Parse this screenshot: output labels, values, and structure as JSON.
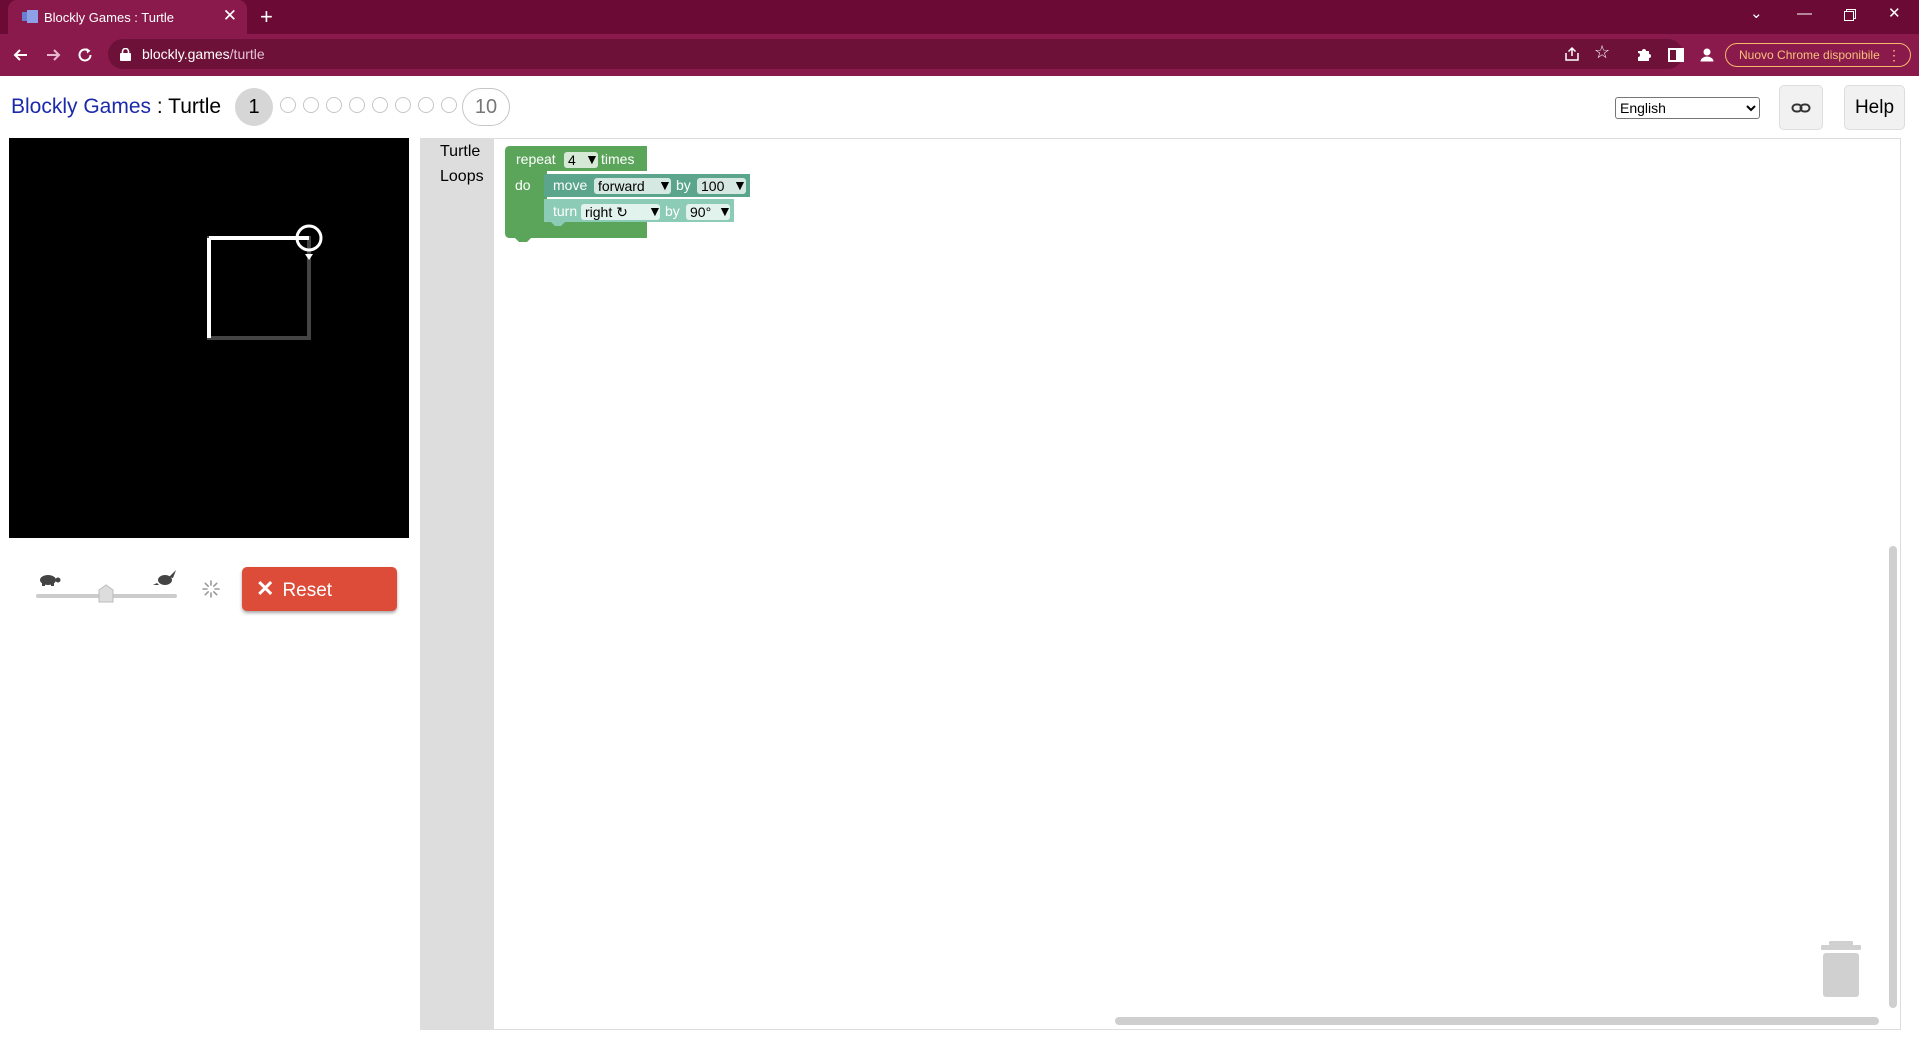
{
  "browser": {
    "tab_title": "Blockly Games : Turtle",
    "url_host": "blockly.games",
    "url_path": "/turtle",
    "update_button_label": "Nuovo Chrome disponibile",
    "theme_color": "#8b1a4c",
    "icons": [
      "tab-favicon",
      "close-icon",
      "new-tab-icon",
      "tab-search-icon",
      "minimize-icon",
      "restore-icon",
      "window-close-icon",
      "back-icon",
      "forward-icon",
      "reload-icon",
      "lock-icon",
      "share-icon",
      "bookmark-star-icon",
      "extensions-icon",
      "side-panel-icon",
      "profile-icon",
      "menu-dots-icon"
    ]
  },
  "header": {
    "app_link": "Blockly Games",
    "separator": " : ",
    "page_title": "Turtle",
    "level_current": "1",
    "level_last": "10",
    "language": "English",
    "language_options": [
      "English"
    ],
    "help_label": "Help",
    "icons": [
      "link-icon"
    ]
  },
  "controls": {
    "reset_label": "Reset",
    "reset_color": "#dd4b39",
    "speed_level": 0.5,
    "icons": [
      "turtle-slow-icon",
      "rabbit-fast-icon",
      "spinner-icon",
      "reset-x-icon"
    ]
  },
  "toolbox": {
    "categories": [
      "Turtle",
      "Loops"
    ]
  },
  "blocks": {
    "repeat_label": "repeat",
    "repeat_count": "4",
    "times_label": "times",
    "do_label": "do",
    "move_label": "move",
    "move_direction": "forward",
    "by_label": "by",
    "move_amount": "100",
    "turn_label": "turn",
    "turn_direction": "right ↻",
    "turn_amount": "90°",
    "loop_color": "#5ba55b",
    "turtle_color": "#5ba58c"
  },
  "workspace": {
    "icons": [
      "trash-icon"
    ]
  }
}
